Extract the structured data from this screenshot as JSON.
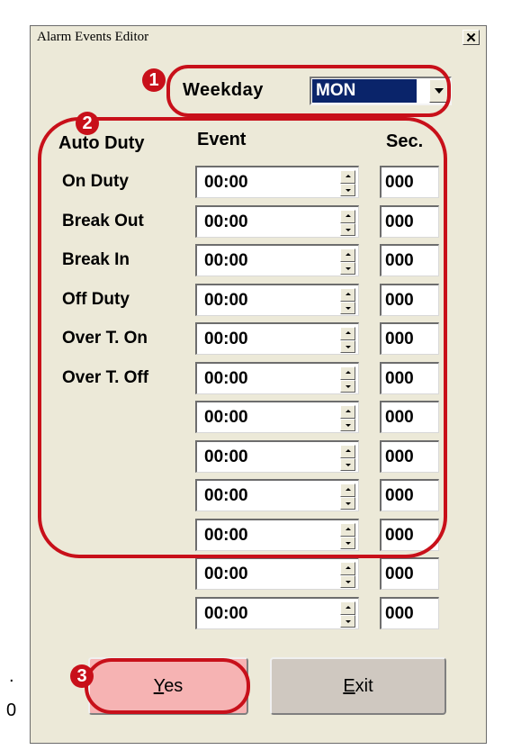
{
  "window": {
    "title": "Alarm Events Editor",
    "close_glyph": "✕"
  },
  "weekday": {
    "label": "Weekday",
    "value": "MON"
  },
  "headers": {
    "auto_duty": "Auto Duty",
    "event": "Event",
    "sec": "Sec."
  },
  "rows": [
    {
      "label": "On Duty",
      "time": "00:00",
      "sec": "000"
    },
    {
      "label": "Break Out",
      "time": "00:00",
      "sec": "000"
    },
    {
      "label": "Break In",
      "time": "00:00",
      "sec": "000"
    },
    {
      "label": "Off Duty",
      "time": "00:00",
      "sec": "000"
    },
    {
      "label": "Over T. On",
      "time": "00:00",
      "sec": "000"
    },
    {
      "label": "Over T. Off",
      "time": "00:00",
      "sec": "000"
    },
    {
      "label": "",
      "time": "00:00",
      "sec": "000"
    },
    {
      "label": "",
      "time": "00:00",
      "sec": "000"
    },
    {
      "label": "",
      "time": "00:00",
      "sec": "000"
    },
    {
      "label": "",
      "time": "00:00",
      "sec": "000"
    },
    {
      "label": "",
      "time": "00:00",
      "sec": "000"
    },
    {
      "label": "",
      "time": "00:00",
      "sec": "000"
    }
  ],
  "buttons": {
    "yes_accel": "Y",
    "yes_rest": "es",
    "exit_accel": "E",
    "exit_rest": "xit"
  },
  "annotations": {
    "badge1": "1",
    "badge2": "2",
    "badge3": "3",
    "ring_color": "#c8101a"
  },
  "edge_text": {
    "dot": ".",
    "digit": "0"
  }
}
